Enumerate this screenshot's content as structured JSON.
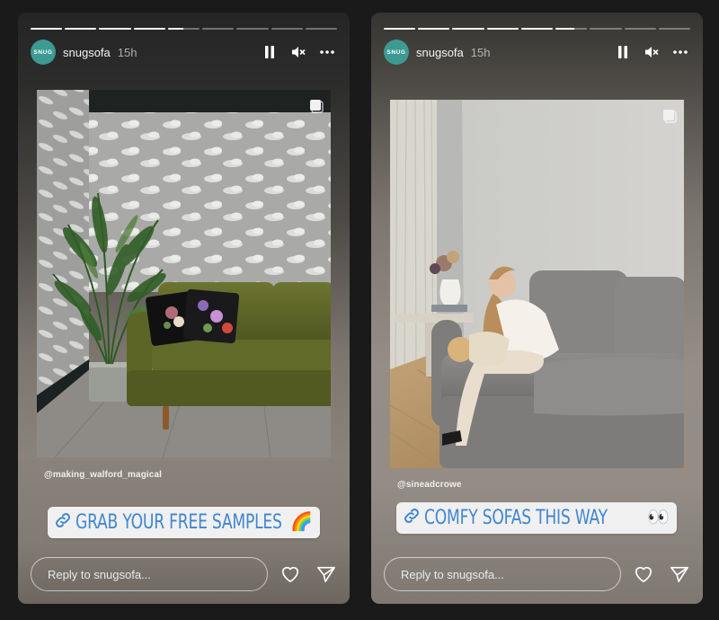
{
  "colors": {
    "page_bg": "#1a1a1a",
    "avatar_bg": "#3c9a93",
    "link_text": "#3f86d0",
    "sticker_bg": "#f0f0f0"
  },
  "stories": [
    {
      "avatar_text": "SNUG",
      "username": "snugsofa",
      "time": "15h",
      "progress": {
        "segments": 9,
        "fills": [
          1,
          1,
          1,
          1,
          0.5,
          0,
          0,
          0,
          0
        ]
      },
      "icons": {
        "pause": "pause-icon",
        "mute": "muted-speaker-icon",
        "more": "more-horizontal-icon"
      },
      "photo": {
        "alt": "Green velvet sofa with floral cushions, palm plant, cloud wallpaper",
        "carousel_icon": "multiple-photos-icon"
      },
      "mention": "@making_walford_magical",
      "link_sticker": {
        "icon": "link-icon",
        "label": "GRAB YOUR FREE SAMPLES",
        "emoji": "🌈"
      },
      "reply": {
        "placeholder": "Reply to snugsofa...",
        "value": ""
      },
      "actions": {
        "like": "heart-icon",
        "share": "send-icon"
      }
    },
    {
      "avatar_text": "SNUG",
      "username": "snugsofa",
      "time": "15h",
      "progress": {
        "segments": 9,
        "fills": [
          1,
          1,
          1,
          1,
          1,
          0.6,
          0,
          0,
          0
        ]
      },
      "icons": {
        "pause": "pause-icon",
        "mute": "muted-speaker-icon",
        "more": "more-horizontal-icon"
      },
      "photo": {
        "alt": "Woman laughing with a toddler on a grey velvet sofa",
        "carousel_icon": "multiple-photos-icon"
      },
      "mention": "@sineadcrowe",
      "link_sticker": {
        "icon": "link-icon",
        "label": "COMFY SOFAS THIS WAY",
        "emoji": "👀"
      },
      "reply": {
        "placeholder": "Reply to snugsofa...",
        "value": ""
      },
      "actions": {
        "like": "heart-icon",
        "share": "send-icon"
      }
    }
  ]
}
